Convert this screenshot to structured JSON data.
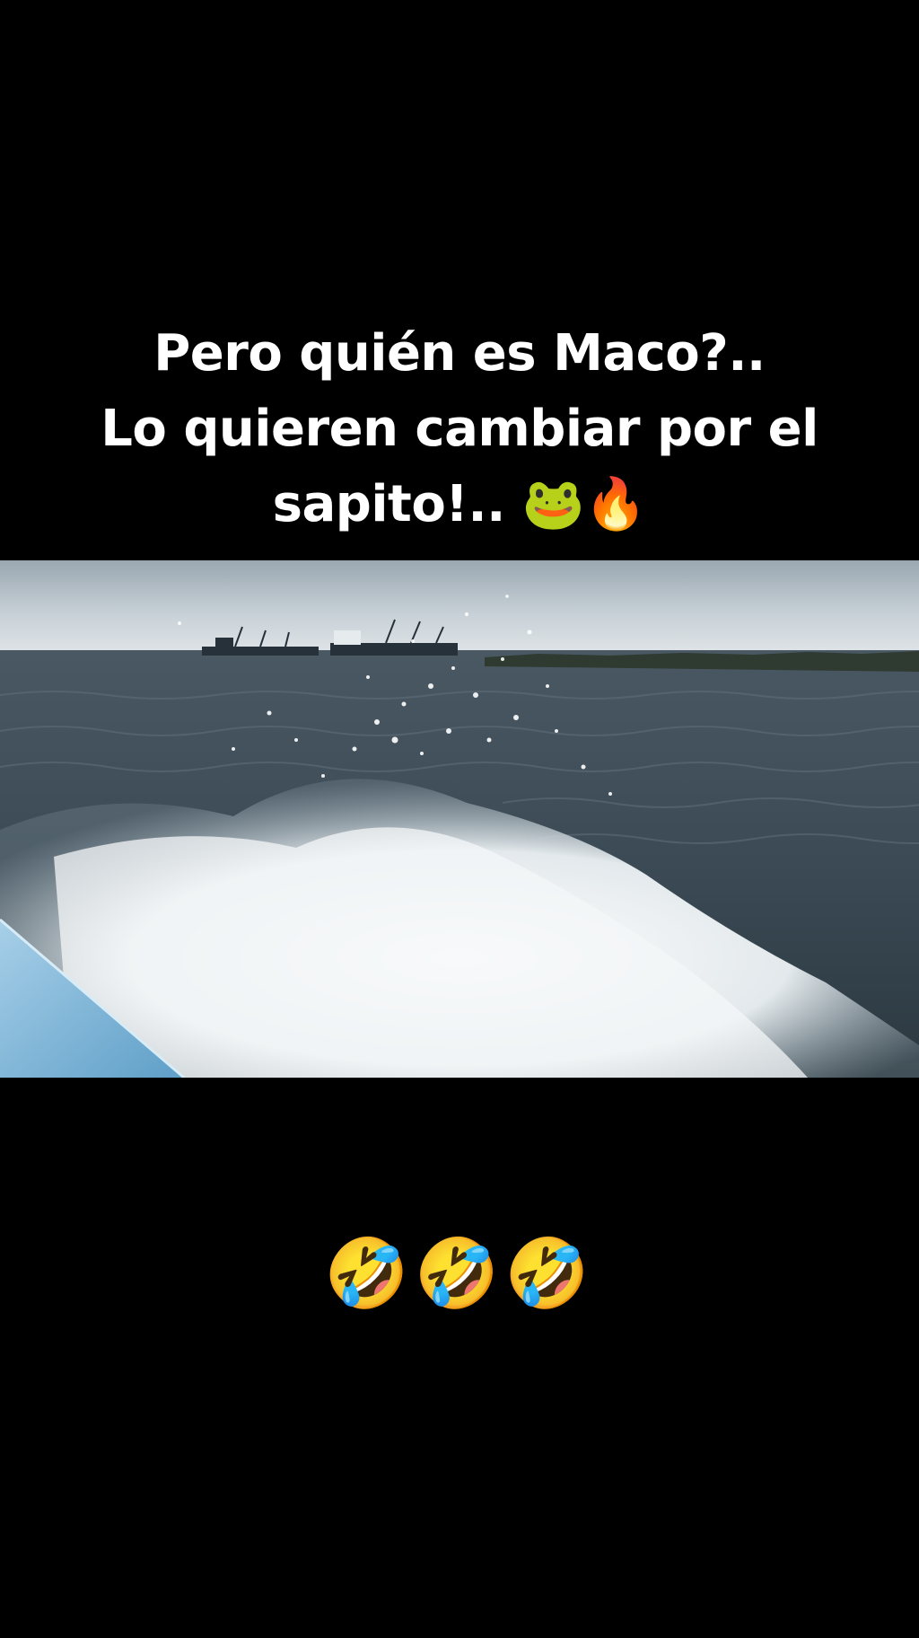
{
  "caption": {
    "line1": "Pero quién es Maco?..",
    "line2": "Lo quieren cambiar por el",
    "line3_text": "sapito!..",
    "line3_emojis": "🐸🔥"
  },
  "reaction_emojis": "🤣🤣🤣",
  "colors": {
    "background": "#000000",
    "caption_text": "#ffffff",
    "sky": "#c9d2d8",
    "sea": "#3b4a55",
    "foam": "#e9eef0",
    "boat_hull": "#7fb5d8"
  }
}
